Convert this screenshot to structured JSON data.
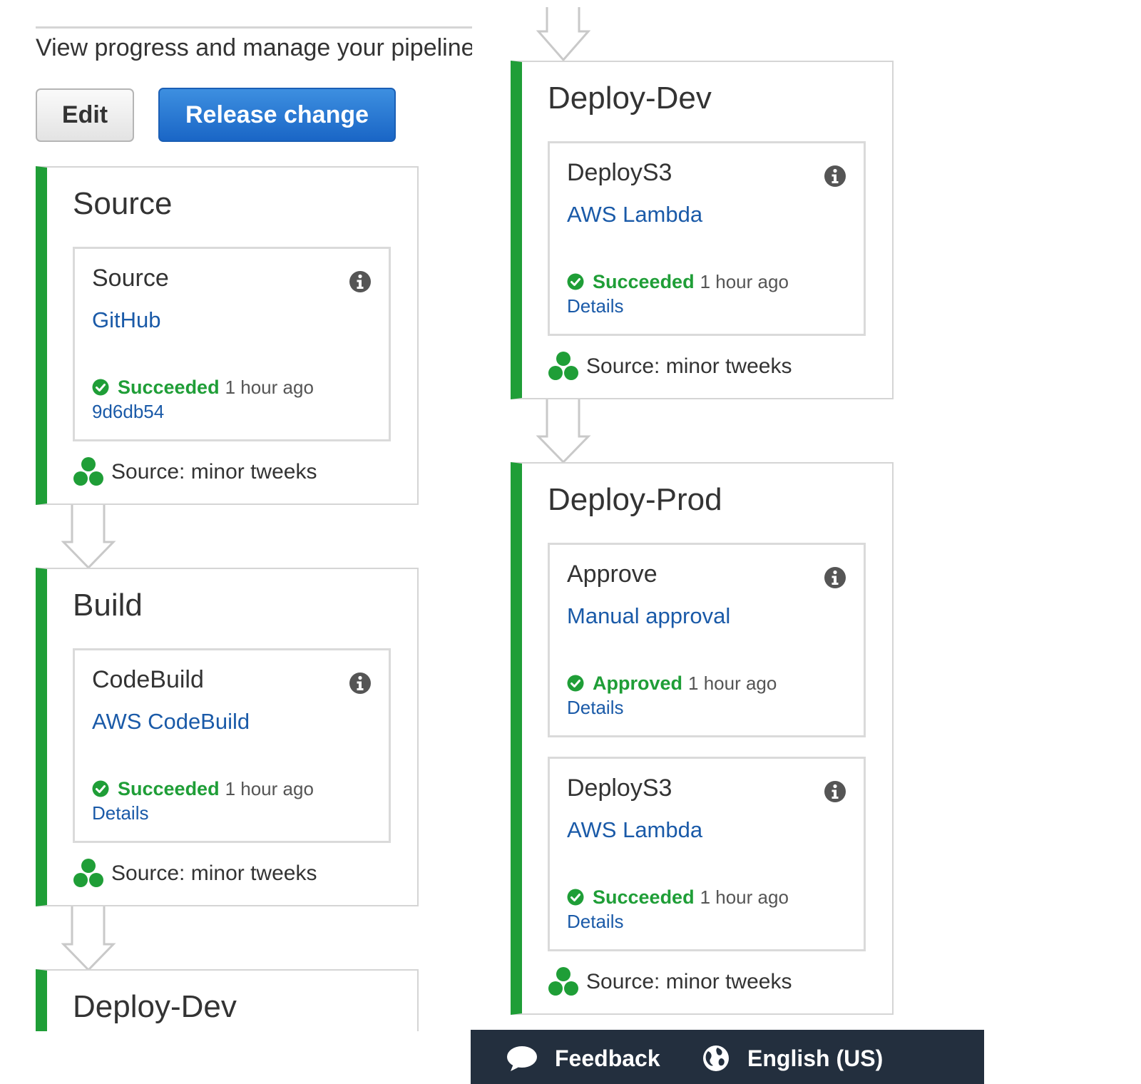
{
  "header": {
    "subtitle": "View progress and manage your pipeline",
    "edit_label": "Edit",
    "release_label": "Release change"
  },
  "stages": [
    {
      "name": "Source",
      "actions": [
        {
          "name": "Source",
          "provider": "GitHub",
          "status": "Succeeded",
          "time": "1 hour ago",
          "link": "9d6db54"
        }
      ],
      "revision": "Source: minor tweeks"
    },
    {
      "name": "Build",
      "actions": [
        {
          "name": "CodeBuild",
          "provider": "AWS CodeBuild",
          "status": "Succeeded",
          "time": "1 hour ago",
          "link": "Details"
        }
      ],
      "revision": "Source: minor tweeks"
    },
    {
      "name": "Deploy-Dev",
      "actions": [
        {
          "name": "DeployS3",
          "provider": "AWS Lambda",
          "status": "Succeeded",
          "time": "1 hour ago",
          "link": "Details"
        }
      ],
      "revision": "Source: minor tweeks"
    },
    {
      "name": "Deploy-Prod",
      "actions": [
        {
          "name": "Approve",
          "provider": "Manual approval",
          "status": "Approved",
          "time": "1 hour ago",
          "link": "Details"
        },
        {
          "name": "DeployS3",
          "provider": "AWS Lambda",
          "status": "Succeeded",
          "time": "1 hour ago",
          "link": "Details"
        }
      ],
      "revision": "Source: minor tweeks"
    }
  ],
  "footer": {
    "feedback_label": "Feedback",
    "language_label": "English (US)"
  },
  "colors": {
    "stage_accent": "#1f9e37",
    "primary_button": "#1a66c6",
    "link": "#1a5aa8",
    "footer_bg": "#232f3e"
  },
  "icons": [
    "info-icon",
    "success-check-icon",
    "revision-icon",
    "flow-arrow",
    "feedback-bubble-icon",
    "globe-icon"
  ]
}
